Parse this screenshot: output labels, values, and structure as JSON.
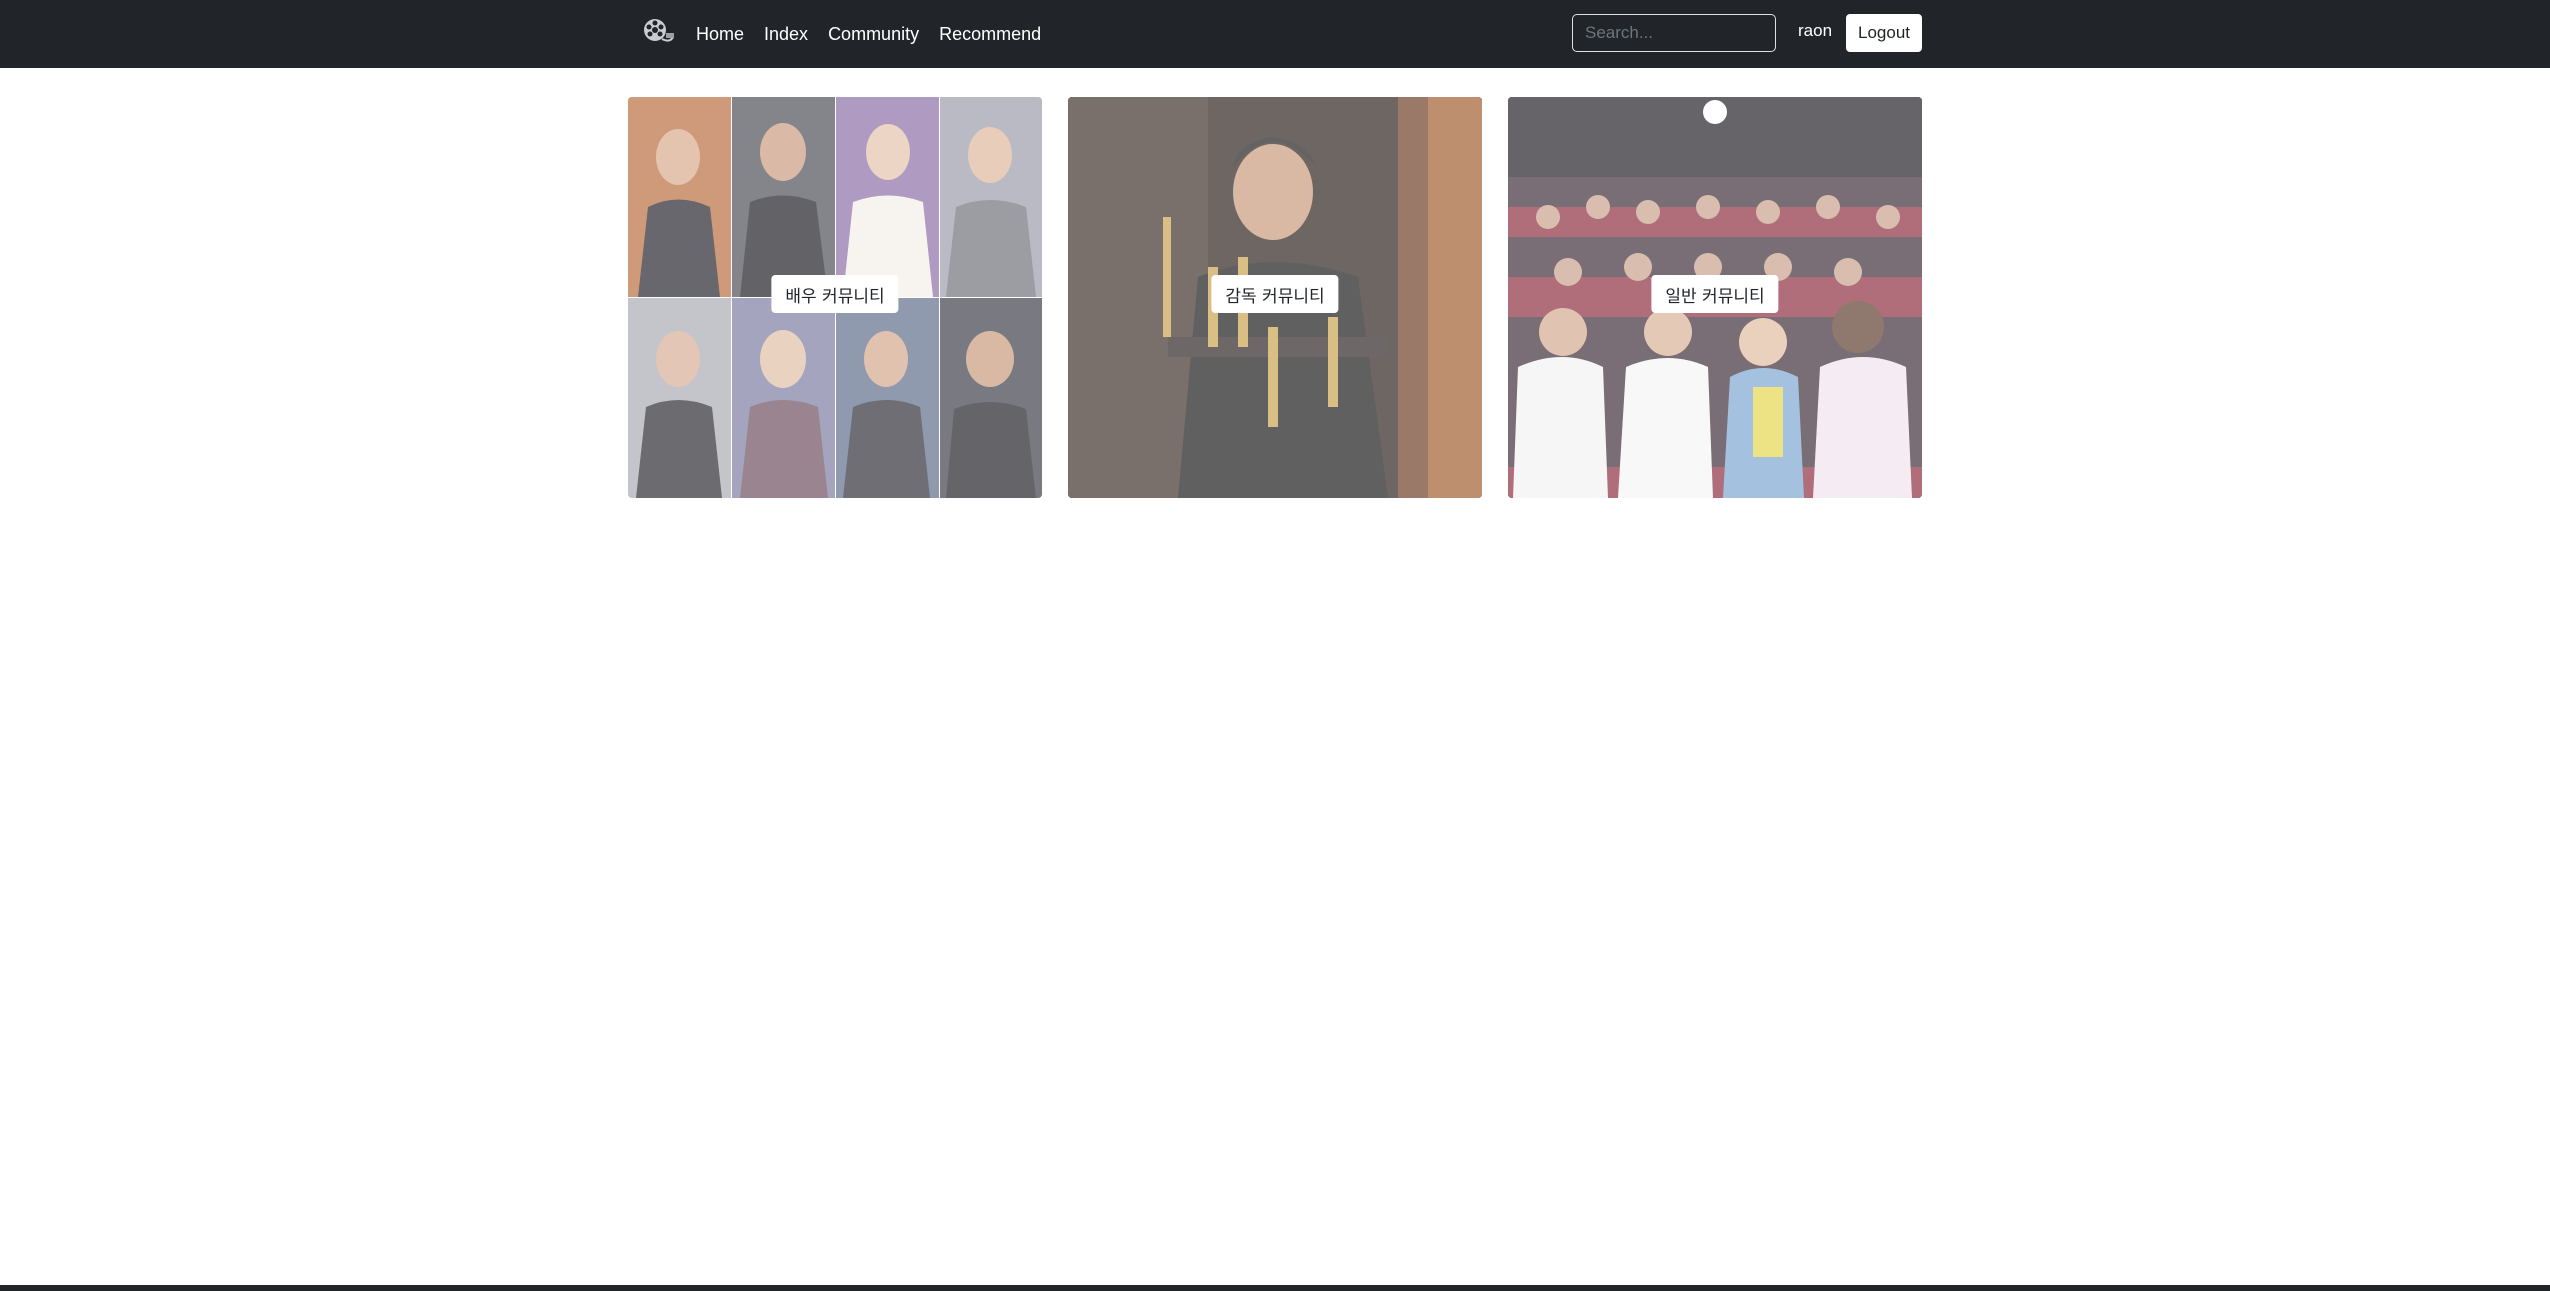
{
  "nav": {
    "links": [
      "Home",
      "Index",
      "Community",
      "Recommend"
    ],
    "search_placeholder": "Search...",
    "username": "raon",
    "logout_label": "Logout"
  },
  "cards": [
    {
      "label": "배우 커뮤니티",
      "image": "actors-collage"
    },
    {
      "label": "감독 커뮤니티",
      "image": "director-with-oscars"
    },
    {
      "label": "일반 커뮤니티",
      "image": "audience-in-theater"
    }
  ],
  "colors": {
    "navbar": "#212529",
    "button_bg": "#ffffff",
    "footer": "#212529"
  }
}
